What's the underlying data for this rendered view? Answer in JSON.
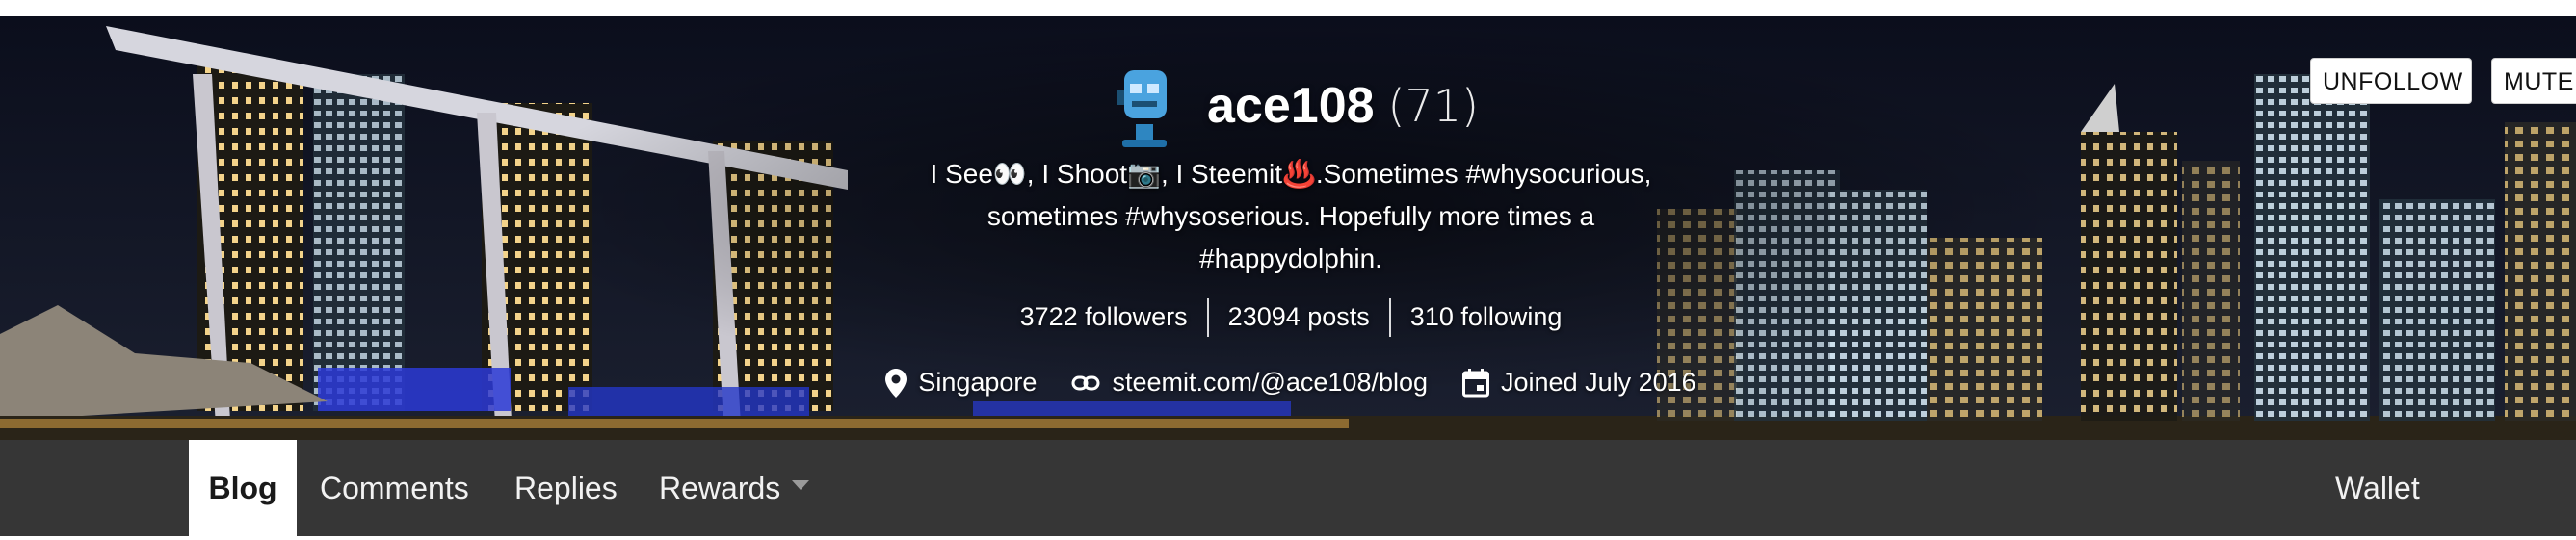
{
  "profile": {
    "name": "ace108",
    "reputation": "(71)",
    "about_line1": "I See👀, I Shoot📷, I Steemit♨️.Sometimes #whysocurious,",
    "about_line2": "sometimes #whysoserious. Hopefully more times a",
    "about_line3": "#happydolphin.",
    "stats": {
      "followers": "3722 followers",
      "posts": "23094 posts",
      "following": "310 following"
    },
    "location": "Singapore",
    "website": "steemit.com/@ace108/blog",
    "joined": "Joined July 2016"
  },
  "actions": {
    "unfollow": "UNFOLLOW",
    "mute": "MUTE"
  },
  "nav": {
    "tabs": [
      "Blog",
      "Comments",
      "Replies",
      "Rewards"
    ],
    "active": "Blog",
    "wallet": "Wallet"
  },
  "icons": {
    "avatar": "robot-microphone-icon",
    "location": "location-pin-icon",
    "link": "link-icon",
    "calendar": "calendar-icon",
    "rewards_dropdown": "caret-down-icon"
  },
  "colors": {
    "navbar": "#363636",
    "active_tab_bg": "#ffffff",
    "banner_night": "#0f1322"
  }
}
